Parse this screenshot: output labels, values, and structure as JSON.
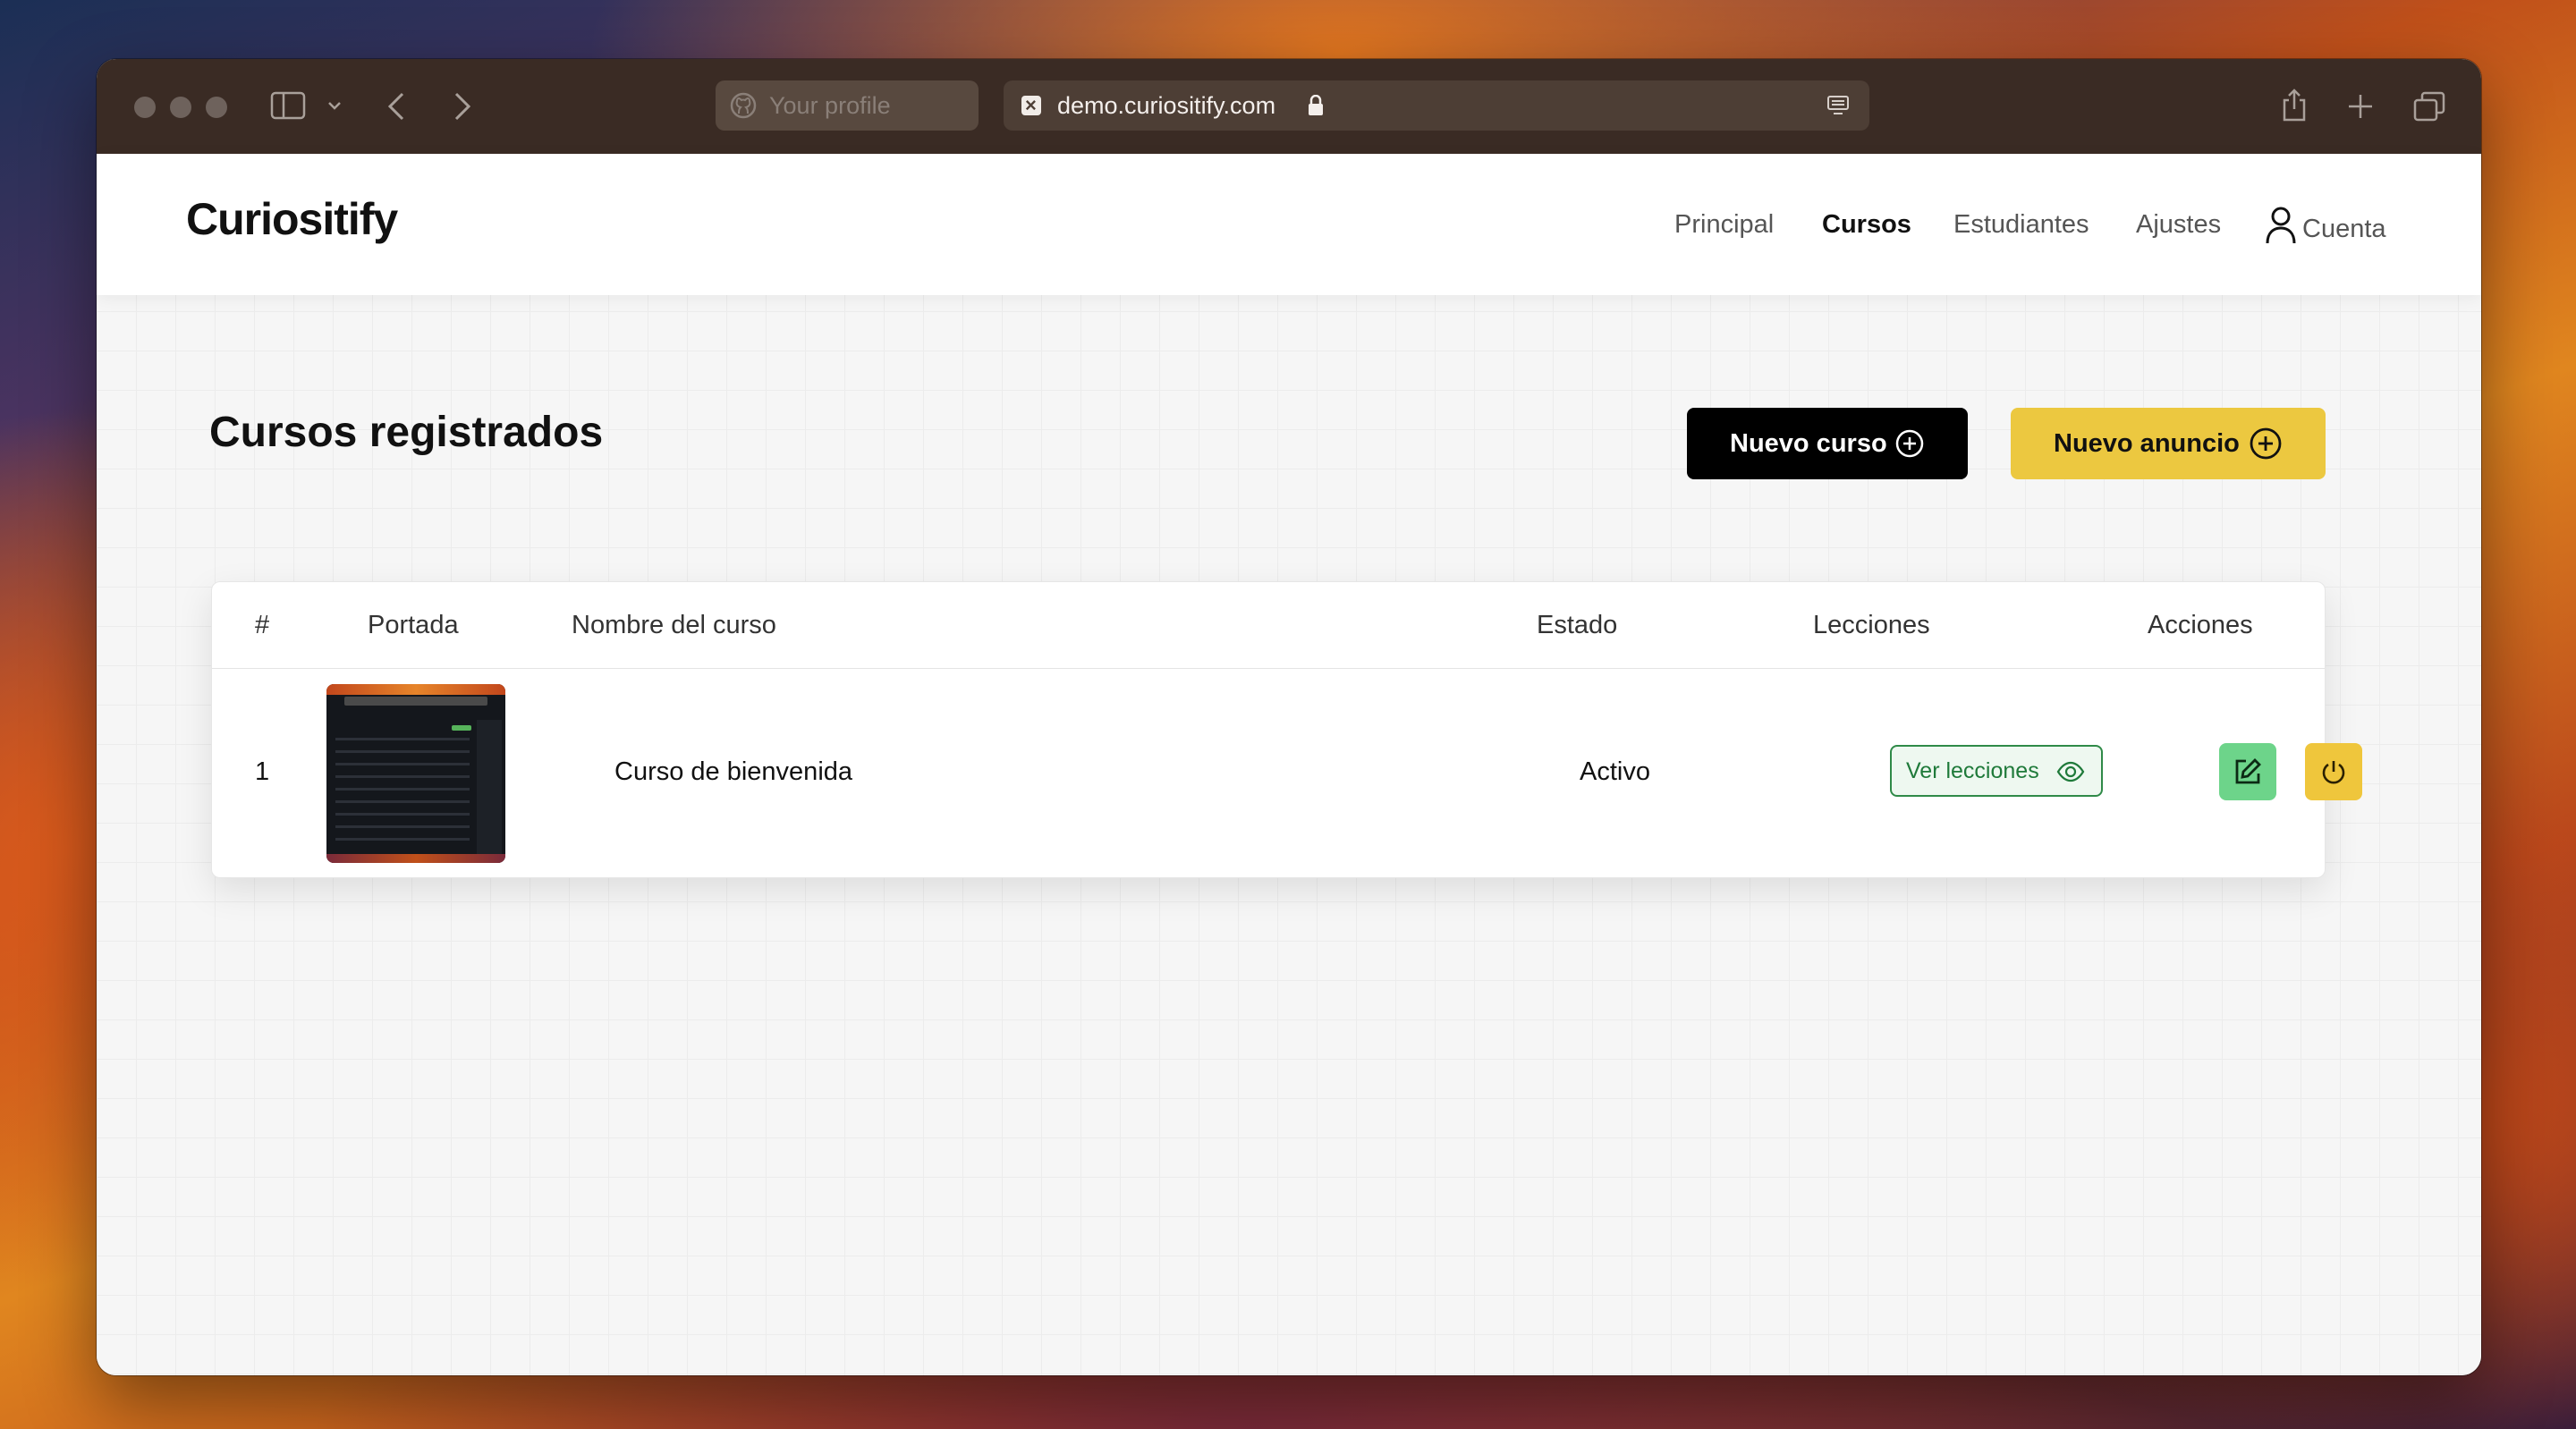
{
  "browser": {
    "profile_tab": "Your profile",
    "url": "demo.curiositify.com"
  },
  "navbar": {
    "logo": "Curiositify",
    "links": [
      {
        "label": "Principal",
        "active": false
      },
      {
        "label": "Cursos",
        "active": true
      },
      {
        "label": "Estudiantes",
        "active": false
      },
      {
        "label": "Ajustes",
        "active": false
      }
    ],
    "account_label": "Cuenta"
  },
  "main": {
    "title": "Cursos registrados",
    "new_course_label": "Nuevo curso",
    "new_announcement_label": "Nuevo anuncio"
  },
  "table": {
    "headers": [
      "#",
      "Portada",
      "Nombre del curso",
      "Estado",
      "Lecciones",
      "Acciones"
    ],
    "rows": [
      {
        "index": "1",
        "name": "Curso de bienvenida",
        "status": "Activo",
        "lessons_label": "Ver lecciones"
      }
    ]
  },
  "colors": {
    "primary_dark": "#000000",
    "accent_yellow": "#ecc840",
    "edit_green": "#6dd48a",
    "badge_green": "#2f8a48"
  },
  "icons": [
    "github-icon",
    "lock-icon",
    "reader-icon",
    "plus-circle-icon",
    "user-icon",
    "eye-icon",
    "edit-icon",
    "power-icon",
    "share-icon",
    "new-tab-icon",
    "tabs-overview-icon",
    "sidebar-icon",
    "back-icon",
    "forward-icon"
  ]
}
